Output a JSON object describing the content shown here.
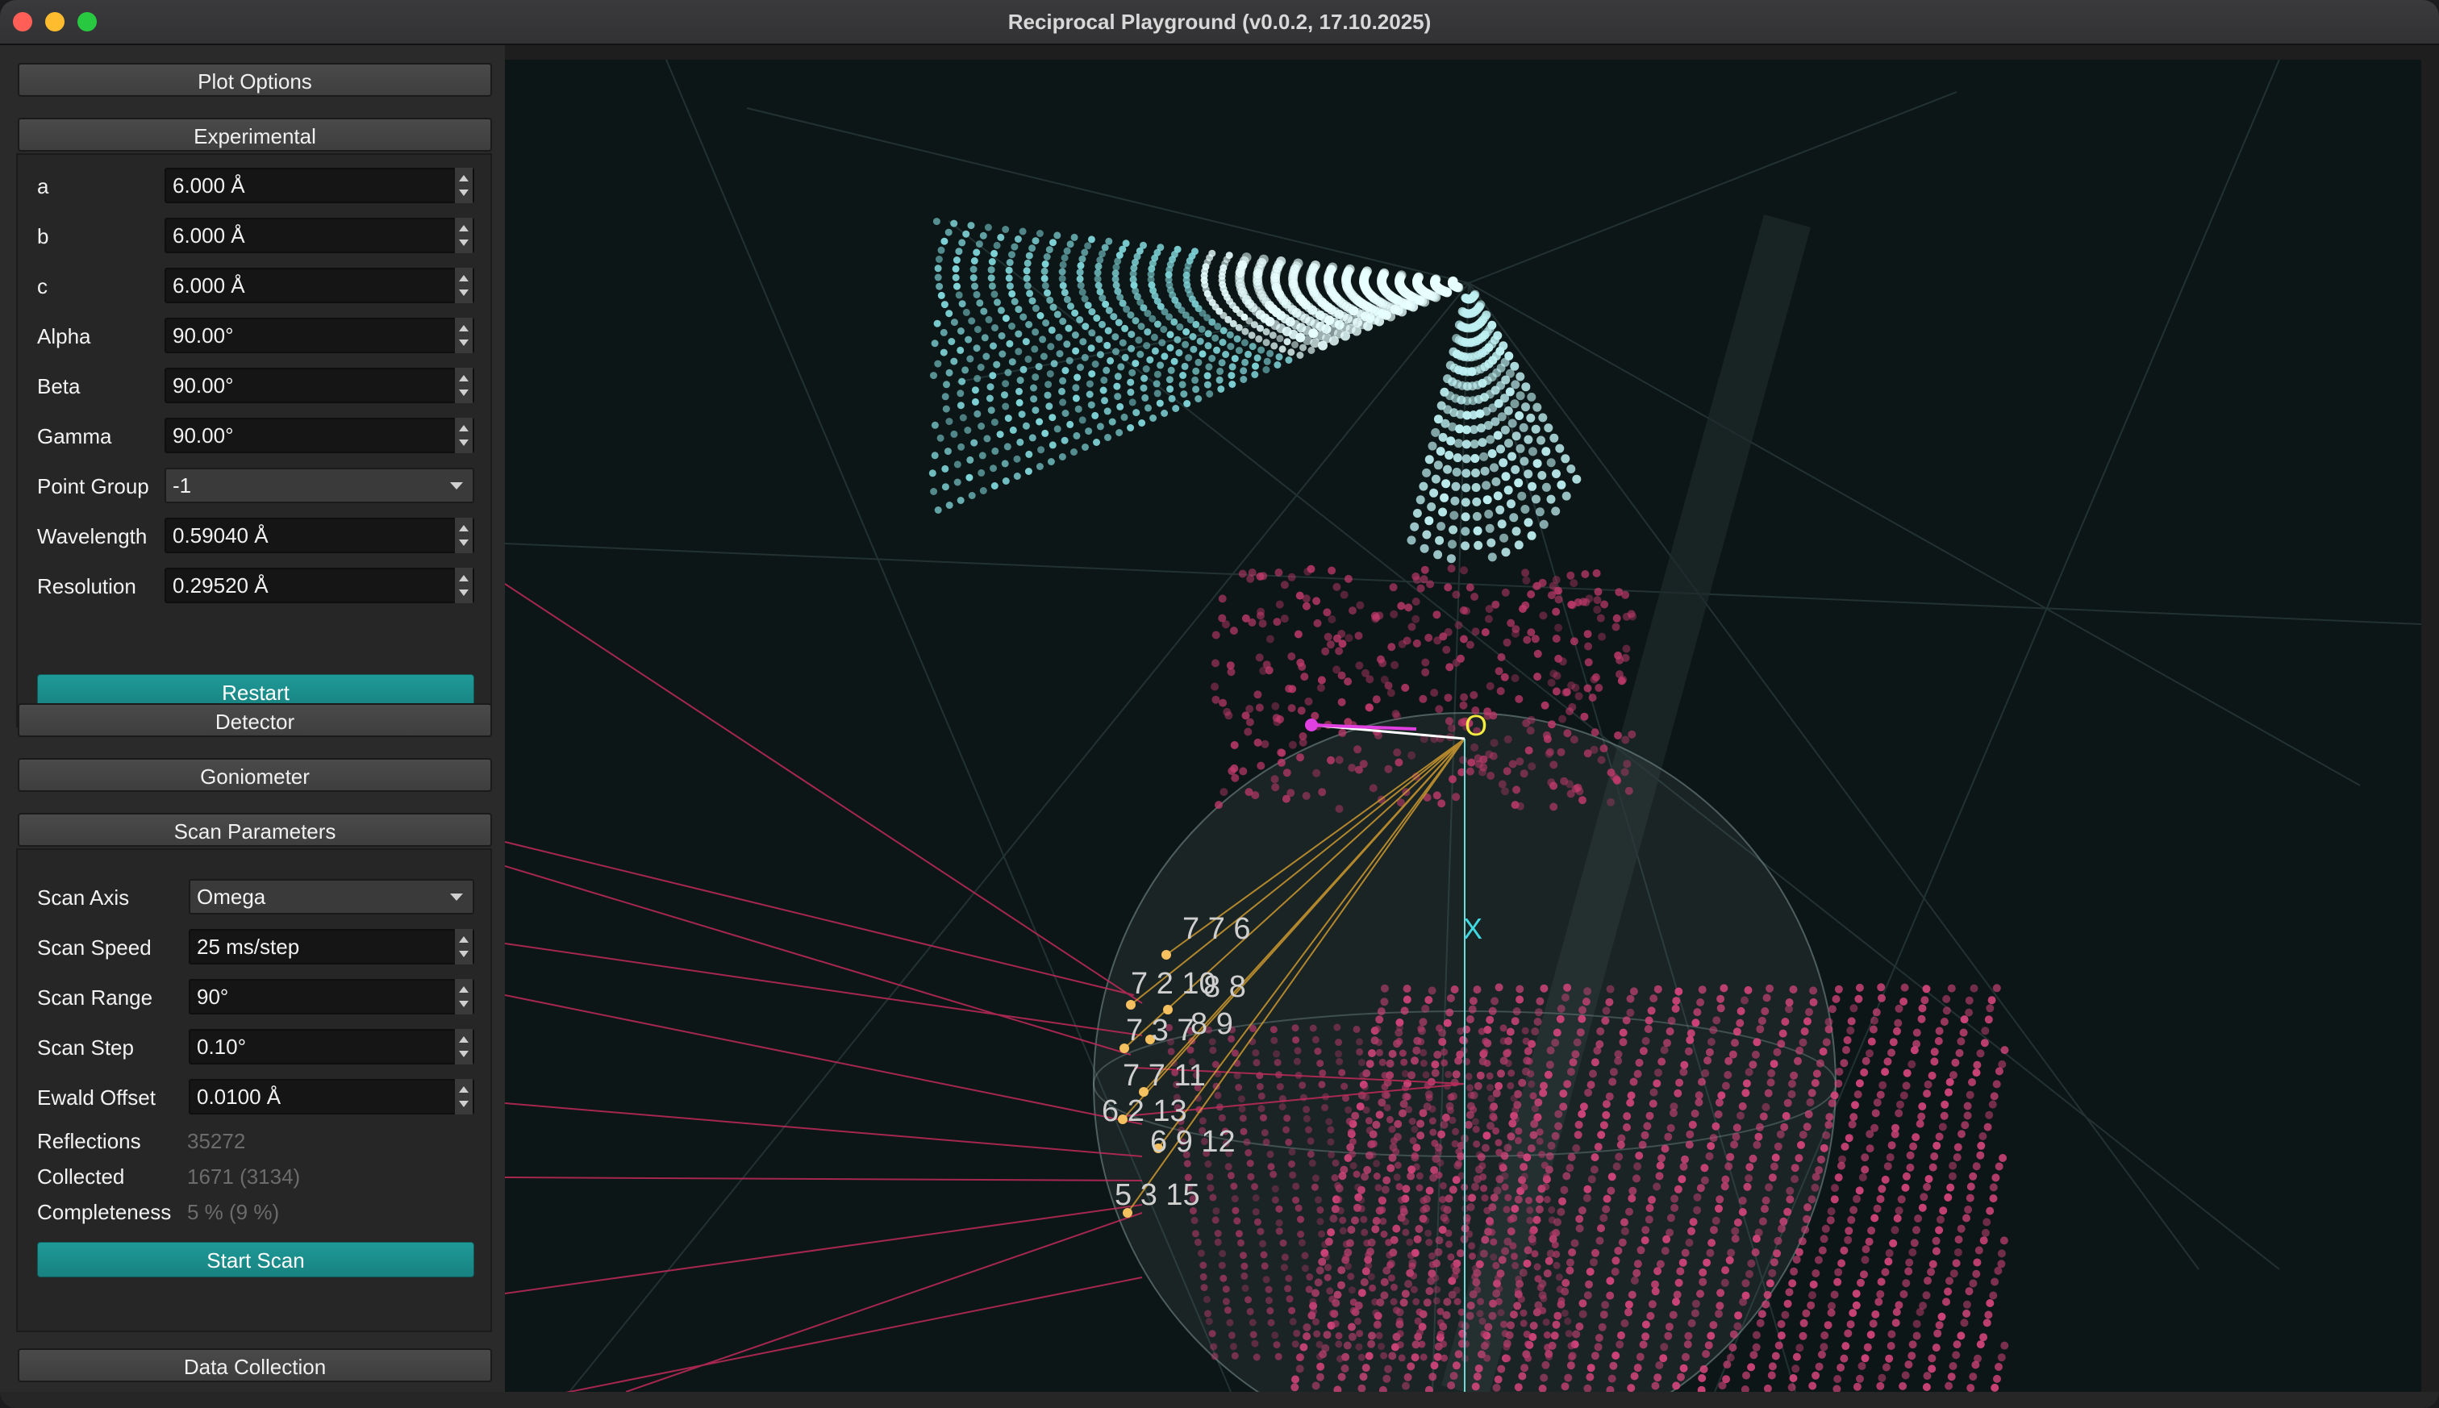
{
  "window": {
    "title": "Reciprocal Playground (v0.0.2, 17.10.2025)"
  },
  "sections": {
    "plot_options": "Plot Options",
    "experimental": "Experimental",
    "detector": "Detector",
    "goniometer": "Goniometer",
    "scan_parameters": "Scan Parameters",
    "data_collection": "Data Collection"
  },
  "experimental": {
    "fields": [
      {
        "label": "a",
        "value": "6.000 Å"
      },
      {
        "label": "b",
        "value": "6.000 Å"
      },
      {
        "label": "c",
        "value": "6.000 Å"
      },
      {
        "label": "Alpha",
        "value": "90.00°"
      },
      {
        "label": "Beta",
        "value": "90.00°"
      },
      {
        "label": "Gamma",
        "value": "90.00°"
      }
    ],
    "point_group_label": "Point Group",
    "point_group_value": "-1",
    "wavelength_label": "Wavelength",
    "wavelength_value": "0.59040 Å",
    "resolution_label": "Resolution",
    "resolution_value": "0.29520 Å",
    "restart_label": "Restart"
  },
  "scan": {
    "axis_label": "Scan Axis",
    "axis_value": "Omega",
    "speed_label": "Scan Speed",
    "speed_value": "25 ms/step",
    "range_label": "Scan Range",
    "range_value": "90°",
    "step_label": "Scan Step",
    "step_value": "0.10°",
    "ewald_label": "Ewald Offset",
    "ewald_value": "0.0100 Å",
    "reflections_label": "Reflections",
    "reflections_value": "35272",
    "collected_label": "Collected",
    "collected_value": "1671 (3134)",
    "completeness_label": "Completeness",
    "completeness_value": "5 % (9 %)",
    "start_label": "Start Scan"
  },
  "viewport": {
    "axis_x_label": "X",
    "axis_o_label": "O",
    "reflection_labels": [
      "7 7 6",
      "7 2 10",
      "8 8",
      "7 3 7",
      "8 9",
      "7 7 11",
      "6 2 13",
      "6 9 12",
      "5 3 15"
    ]
  },
  "colors": {
    "accent_teal": "#1f9a98",
    "reflection_pink": "#d6457d",
    "lattice_cyan": "#7fd4d8",
    "background": "#0d1616"
  }
}
